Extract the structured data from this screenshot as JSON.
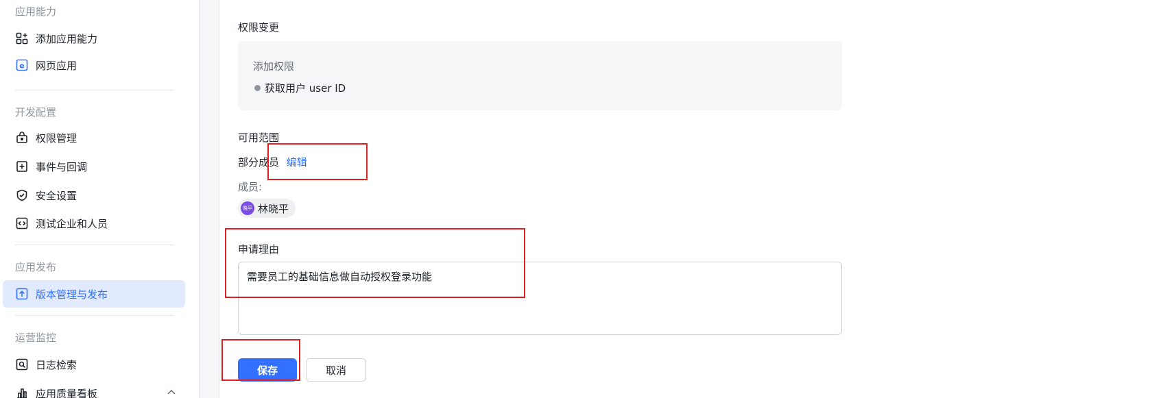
{
  "sidebar": {
    "sections": [
      {
        "title": "应用能力",
        "items": [
          {
            "label": "添加应用能力",
            "icon": "grid-add-icon"
          },
          {
            "label": "网页应用",
            "icon": "web-app-icon"
          }
        ]
      },
      {
        "title": "开发配置",
        "items": [
          {
            "label": "权限管理",
            "icon": "lock-icon"
          },
          {
            "label": "事件与回调",
            "icon": "event-icon"
          },
          {
            "label": "安全设置",
            "icon": "shield-icon"
          },
          {
            "label": "测试企业和人员",
            "icon": "code-icon"
          }
        ]
      },
      {
        "title": "应用发布",
        "items": [
          {
            "label": "版本管理与发布",
            "icon": "upload-icon",
            "active": true
          }
        ]
      },
      {
        "title": "运营监控",
        "items": [
          {
            "label": "日志检索",
            "icon": "log-search-icon"
          },
          {
            "label": "应用质量看板",
            "icon": "bar-chart-icon"
          }
        ]
      }
    ]
  },
  "main": {
    "permission_change": {
      "title": "权限变更",
      "subtitle": "添加权限",
      "items": [
        "获取用户 user ID"
      ]
    },
    "scope": {
      "title": "可用范围",
      "value": "部分成员",
      "edit_label": "编辑",
      "members_label": "成员:",
      "members": [
        {
          "name": "林晓平",
          "avatar_text": "晓平"
        }
      ]
    },
    "reason": {
      "title": "申请理由",
      "value": "需要员工的基础信息做自动授权登录功能"
    },
    "actions": {
      "save": "保存",
      "cancel": "取消"
    }
  },
  "colors": {
    "accent": "#3370ff",
    "active_bg": "#e1eaff",
    "annotation": "#e02020",
    "avatar": "#7b4ce6"
  }
}
